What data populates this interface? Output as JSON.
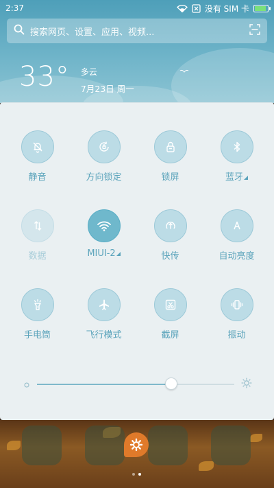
{
  "status": {
    "time": "2:37",
    "carrier": "没有 SIM 卡",
    "battery_level": 0.95,
    "icons": [
      "wifi-icon",
      "sim-x-icon",
      "battery-icon"
    ]
  },
  "search": {
    "placeholder": "搜索网页、设置、应用、视频..."
  },
  "weather": {
    "temperature": "33°",
    "condition": "多云",
    "date": "7月23日 周一"
  },
  "tiles": [
    {
      "label": "静音",
      "icon": "bell-off-icon",
      "state": "normal",
      "has_more": false
    },
    {
      "label": "方向锁定",
      "icon": "rotation-lock-icon",
      "state": "normal",
      "has_more": false
    },
    {
      "label": "锁屏",
      "icon": "lock-icon",
      "state": "normal",
      "has_more": false
    },
    {
      "label": "蓝牙",
      "icon": "bluetooth-icon",
      "state": "normal",
      "has_more": true
    },
    {
      "label": "数据",
      "icon": "mobile-data-icon",
      "state": "disabled",
      "has_more": false
    },
    {
      "label": "MIUI-2",
      "icon": "wifi-icon",
      "state": "active",
      "has_more": true
    },
    {
      "label": "快传",
      "icon": "quick-transfer-icon",
      "state": "normal",
      "has_more": false
    },
    {
      "label": "自动亮度",
      "icon": "auto-brightness-icon",
      "state": "normal",
      "has_more": false
    },
    {
      "label": "手电筒",
      "icon": "flashlight-icon",
      "state": "normal",
      "has_more": false
    },
    {
      "label": "飞行模式",
      "icon": "airplane-icon",
      "state": "normal",
      "has_more": false
    },
    {
      "label": "截屏",
      "icon": "screenshot-icon",
      "state": "normal",
      "has_more": false
    },
    {
      "label": "振动",
      "icon": "vibrate-icon",
      "state": "normal",
      "has_more": false
    }
  ],
  "brightness": {
    "level": 0.68
  },
  "colors": {
    "accent": "#5aa3bb",
    "panel": "#eaf0f2",
    "header": "#6fb4c9",
    "active_tile": "#6fb8cc"
  },
  "home": {
    "page_count": 2,
    "current_page": 1
  }
}
